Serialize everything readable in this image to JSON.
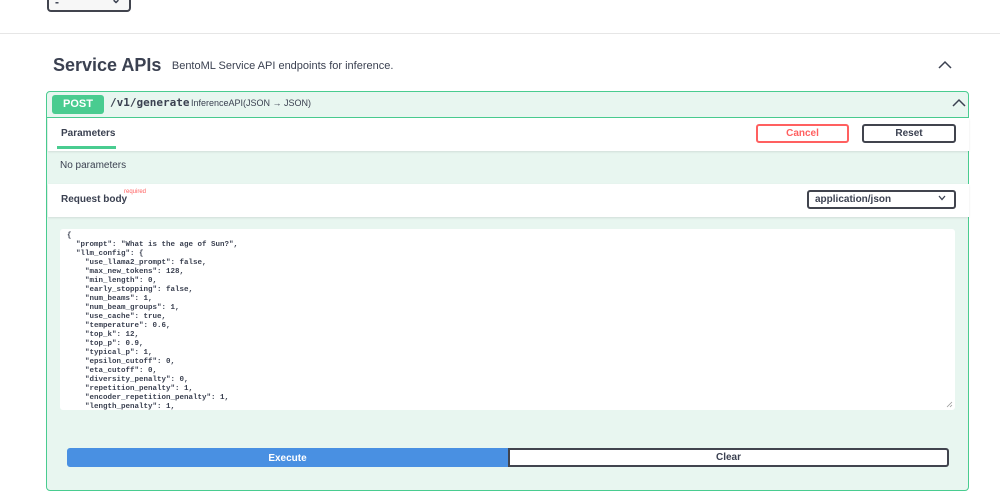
{
  "top": {
    "select_value": "-"
  },
  "section": {
    "title": "Service APIs",
    "description": "BentoML Service API endpoints for inference."
  },
  "operation": {
    "method": "POST",
    "path": "/v1/generate",
    "summary": "InferenceAPI(JSON → JSON)",
    "tabs": {
      "parameters": "Parameters"
    },
    "buttons": {
      "cancel": "Cancel",
      "reset": "Reset",
      "execute": "Execute",
      "clear": "Clear"
    },
    "no_parameters": "No parameters",
    "request_body": {
      "label": "Request body",
      "required": "required",
      "content_type": "application/json",
      "body": "{\n  \"prompt\": \"What is the age of Sun?\",\n  \"llm_config\": {\n    \"use_llama2_prompt\": false,\n    \"max_new_tokens\": 128,\n    \"min_length\": 0,\n    \"early_stopping\": false,\n    \"num_beams\": 1,\n    \"num_beam_groups\": 1,\n    \"use_cache\": true,\n    \"temperature\": 0.6,\n    \"top_k\": 12,\n    \"top_p\": 0.9,\n    \"typical_p\": 1,\n    \"epsilon_cutoff\": 0,\n    \"eta_cutoff\": 0,\n    \"diversity_penalty\": 0,\n    \"repetition_penalty\": 1,\n    \"encoder_repetition_penalty\": 1,\n    \"length_penalty\": 1,"
    }
  },
  "colors": {
    "post": "#49cc90",
    "execute": "#4990e2",
    "cancel": "#ff6060"
  },
  "icons": [
    "chevron-down-icon",
    "chevron-up-icon",
    "resize-handle-icon"
  ]
}
